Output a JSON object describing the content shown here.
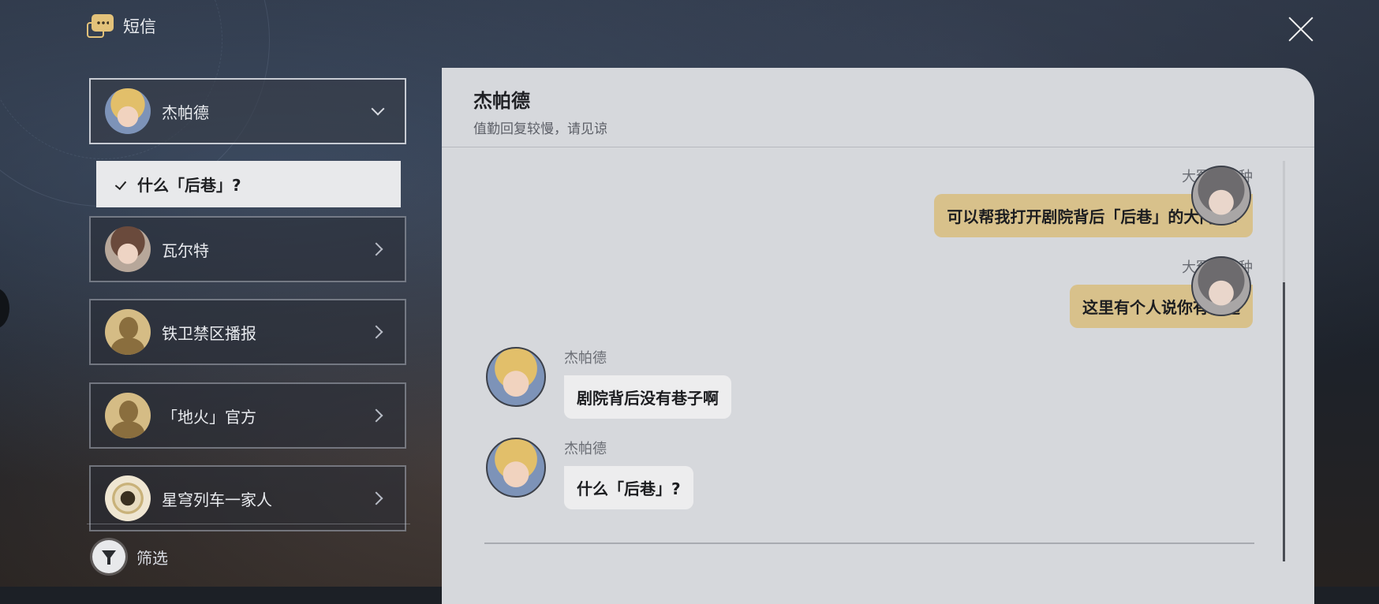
{
  "header": {
    "title": "短信",
    "icon": "message-icon"
  },
  "contacts": [
    {
      "name": "杰帕德",
      "avatar": "jepard-avatar",
      "expanded": true
    },
    {
      "name": "瓦尔特",
      "avatar": "welt-avatar"
    },
    {
      "name": "铁卫禁区播报",
      "avatar": "silhouette-avatar"
    },
    {
      "name": "「地火」官方",
      "avatar": "silhouette-avatar"
    },
    {
      "name": "星穹列车一家人",
      "avatar": "train-avatar"
    }
  ],
  "selected_topic": "什么「后巷」?",
  "filter": {
    "label": "筛选"
  },
  "chat": {
    "name": "杰帕德",
    "status": "值勤回复较慢，请见谅",
    "messages": [
      {
        "sender": "大冤种本种",
        "text": "可以帮我打开剧院背后「后巷」的大门吗?",
        "direction": "out"
      },
      {
        "sender": "大冤种本种",
        "text": "这里有个人说你有钥匙",
        "direction": "out"
      },
      {
        "sender": "杰帕德",
        "text": "剧院背后没有巷子啊",
        "direction": "in"
      },
      {
        "sender": "杰帕德",
        "text": "什么「后巷」?",
        "direction": "in"
      }
    ]
  },
  "colors": {
    "outgoing_bubble": "#d8c18b",
    "incoming_bubble": "#ededee",
    "panel": "#d6d8dc"
  }
}
